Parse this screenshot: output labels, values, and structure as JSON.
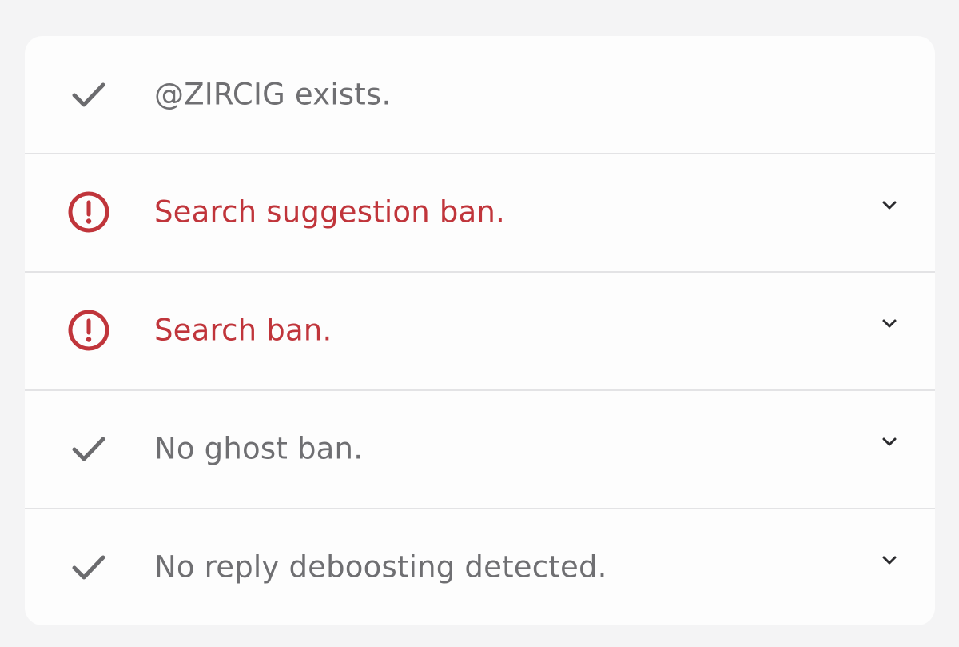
{
  "colors": {
    "ok": "#6f6f72",
    "bad": "#c0353b",
    "icon_ok": "#6b6b6e",
    "chevron": "#2b2b2e"
  },
  "checks": [
    {
      "status": "ok",
      "icon": "check-icon",
      "label": "@ZIRCIG exists.",
      "expandable": false
    },
    {
      "status": "bad",
      "icon": "alert-circle-icon",
      "label": "Search suggestion ban.",
      "expandable": true
    },
    {
      "status": "bad",
      "icon": "alert-circle-icon",
      "label": "Search ban.",
      "expandable": true
    },
    {
      "status": "ok",
      "icon": "check-icon",
      "label": "No ghost ban.",
      "expandable": true
    },
    {
      "status": "ok",
      "icon": "check-icon",
      "label": "No reply deboosting detected.",
      "expandable": true
    }
  ]
}
